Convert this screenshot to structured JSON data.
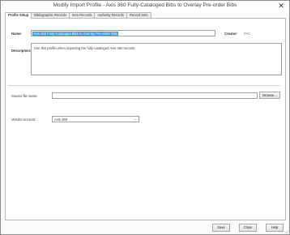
{
  "window": {
    "title": "Modify Import Profile - Axis 360 Fully-Cataloged Bibs to Overlay Pre-order Bibs",
    "close_glyph": "✕"
  },
  "tabs": [
    {
      "label": "Profile Setup",
      "active": true
    },
    {
      "label": "Bibliographic Records",
      "active": false
    },
    {
      "label": "Item Records",
      "active": false
    },
    {
      "label": "Authority Records",
      "active": false
    },
    {
      "label": "Record Sets",
      "active": false
    }
  ],
  "profile": {
    "name_label": "Name:",
    "name_value": "Axis 360 Fully-Cataloged Bibs to Overlay Pre-order Bibs",
    "creator_label": "Creator:",
    "creator_value": "PAC",
    "description_label": "Description:",
    "description_value": "Use this profile when importing the fully-cataloged Axis 360 records",
    "source_label": "Source file name:",
    "source_value": "",
    "browse_label": "Browse...",
    "vendor_label": "Vendor account:",
    "vendor_value": "Axis 360",
    "vendor_chevron": "⌄"
  },
  "footer": {
    "save_label": "Save",
    "close_label": "Close",
    "help_label": "Help"
  },
  "colors": {
    "selection": "#3399ff",
    "panel_border": "#b8b8b8"
  }
}
